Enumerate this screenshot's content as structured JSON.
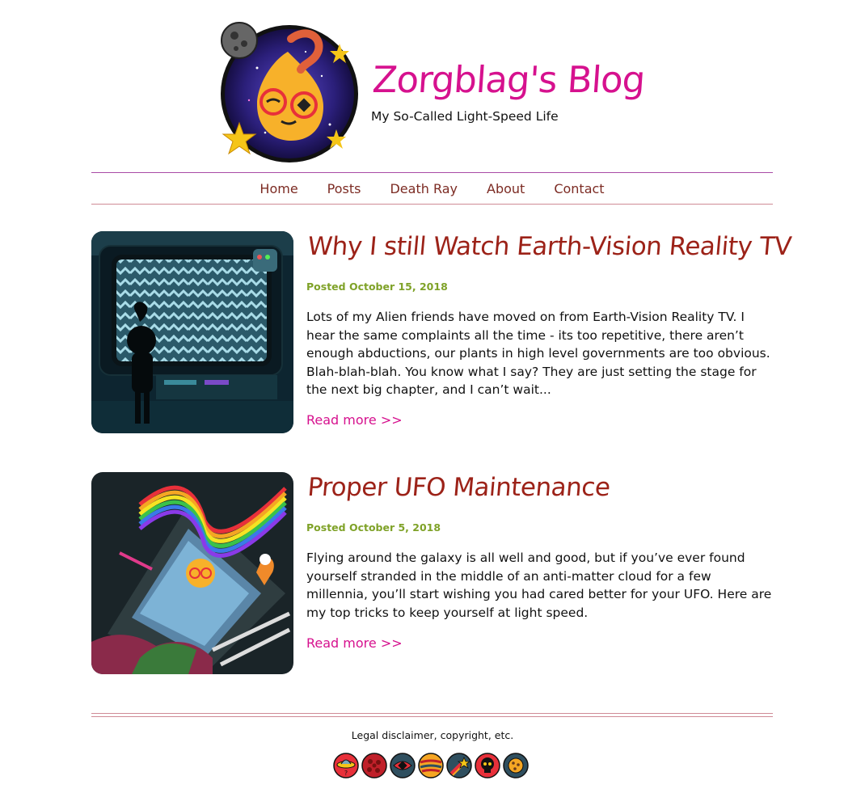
{
  "header": {
    "title": "Zorgblag's Blog",
    "subtitle": "My So-Called Light-Speed Life"
  },
  "nav": {
    "items": [
      {
        "label": "Home"
      },
      {
        "label": "Posts"
      },
      {
        "label": "Death Ray"
      },
      {
        "label": "About"
      },
      {
        "label": "Contact"
      }
    ]
  },
  "posts": [
    {
      "title": "Why I still Watch Earth-Vision Reality TV",
      "date": "Posted October 15, 2018",
      "excerpt": "Lots of my Alien friends have moved on from Earth-Vision Reality TV. I hear the same complaints all the time - its too repetitive, there aren’t enough abductions, our plants in high level governments are too obvious. Blah-blah-blah. You know what I say? They are just setting the stage for the next big chapter, and I can’t wait...",
      "read_more": "Read more >>"
    },
    {
      "title": "Proper UFO Maintenance",
      "date": "Posted October 5, 2018",
      "excerpt": "Flying around the galaxy is all well and good, but if you’ve ever found yourself stranded in the middle of an anti-matter cloud for a few millennia, you’ll start wishing you had cared better for your UFO. Here are my top tricks to keep yourself at light speed.",
      "read_more": "Read more >>"
    }
  ],
  "footer": {
    "text": "Legal disclaimer, copyright, etc.",
    "icons": [
      "ufo-icon",
      "asteroid-icon",
      "eye-icon",
      "planet-icon",
      "comet-icon",
      "skull-icon",
      "cookie-icon"
    ]
  },
  "colors": {
    "title_magenta": "#d6118e",
    "post_title_red": "#9c2218",
    "date_green": "#7fa228",
    "nav_brown": "#7c2b23",
    "rule_pink": "#cf8b96"
  }
}
